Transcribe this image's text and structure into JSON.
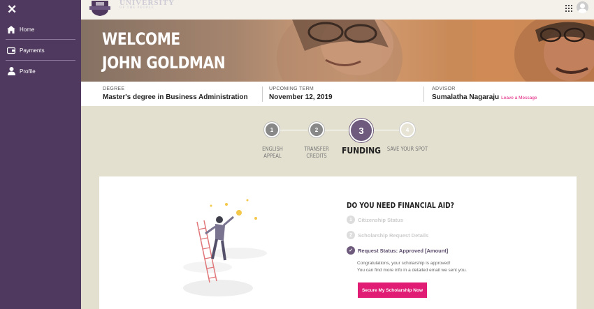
{
  "sidebar": {
    "close_icon": "close-icon",
    "items": [
      {
        "label": "Home",
        "icon": "home-icon"
      },
      {
        "label": "Payments",
        "icon": "payments-icon"
      },
      {
        "label": "Profile",
        "icon": "profile-icon"
      }
    ]
  },
  "topbar": {
    "logo_line1": "UNIVERSITY",
    "logo_line2": "OF THE PEOPLE",
    "apps_icon": "apps-grid-icon",
    "avatar_icon": "user-avatar-icon"
  },
  "hero": {
    "welcome": "WELCOME",
    "name": "JOHN GOLDMAN"
  },
  "info": {
    "degree_label": "DEGREE",
    "degree_value": "Master's degree in Business Administration",
    "term_label": "UPCOMING TERM",
    "term_value": "November 12, 2019",
    "advisor_label": "ADVISOR",
    "advisor_value": "Sumalatha Nagaraju",
    "advisor_link": "Leave a Message"
  },
  "steps": [
    {
      "number": "1",
      "label_line1": "ENGLISH",
      "label_line2": "APPEAL"
    },
    {
      "number": "2",
      "label_line1": "TRANSFER",
      "label_line2": "CREDITS"
    },
    {
      "number": "3",
      "label_line1": "FUNDING",
      "label_line2": ""
    },
    {
      "number": "4",
      "label_line1": "SAVE YOUR SPOT",
      "label_line2": ""
    }
  ],
  "aid": {
    "title": "DO YOU NEED FINANCIAL AID?",
    "items": [
      {
        "number": "1",
        "label": "Citizenship Status"
      },
      {
        "number": "2",
        "label": "Scholarship Request Details"
      },
      {
        "number": "✓",
        "label": "Request Status: Approved [Amount]"
      }
    ],
    "note_line1": "Congratulations, your scholarship is approved!",
    "note_line2": "You can find more info in a detailed email we sent you.",
    "cta": "Secure My Scholarship Now"
  },
  "colors": {
    "sidebar": "#50395f",
    "accent": "#e01c74",
    "active_step": "#6d5a7c",
    "background": "#e3e0cf"
  }
}
